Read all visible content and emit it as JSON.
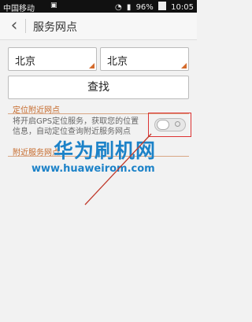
{
  "status_bar": {
    "carrier": "中国移动",
    "battery": "96%",
    "time": "10:05"
  },
  "header": {
    "title": "服务网点"
  },
  "filters": {
    "province": "北京",
    "city": "北京",
    "search_label": "查找"
  },
  "sections": {
    "locate": {
      "title": "定位附近网点",
      "description": "将开启GPS定位服务，获取您的位置信息，自动定位查询附近服务网点",
      "toggle_on": false
    },
    "nearby": {
      "title": "附近服务网点"
    }
  },
  "watermark": {
    "text": "华为刷机网",
    "url": "www.huaweirom.com"
  },
  "colors": {
    "accent": "#c66a2b",
    "highlight": "#dd3333",
    "watermark": "#1c82c8"
  }
}
